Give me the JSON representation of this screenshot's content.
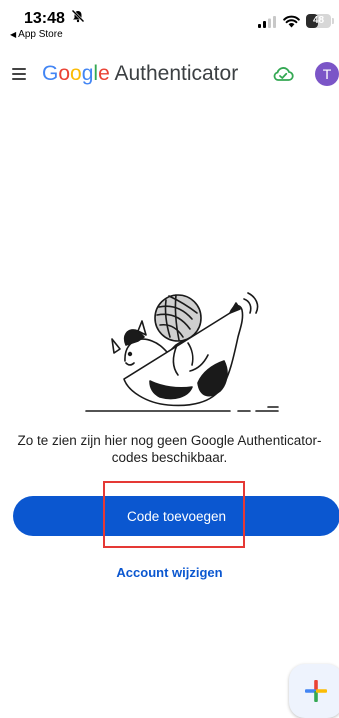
{
  "status_bar": {
    "time": "13:48",
    "back_label": "App Store",
    "battery": "48",
    "battery_level": 0.48,
    "icons": [
      "bell-slash-icon",
      "signal-icon",
      "wifi-icon",
      "battery-icon"
    ]
  },
  "app_bar": {
    "logo_letters": [
      "G",
      "o",
      "o",
      "g",
      "l",
      "e"
    ],
    "logo_colors": [
      "#4285F4",
      "#EA4335",
      "#FBBC05",
      "#4285F4",
      "#34A853",
      "#EA4335"
    ],
    "title_suffix": " Authenticator",
    "avatar_initial": "T",
    "avatar_color": "#7b55c7",
    "sync_status_color": "#34A853",
    "icons": [
      "menu-icon",
      "cloud-check-icon"
    ]
  },
  "empty_state": {
    "illustration": "cat-with-yarn-ball",
    "message": "Zo te zien zijn hier nog geen Google Authenticator-codes beschikbaar.",
    "primary_button": "Code toevoegen",
    "secondary_link": "Account wijzigen"
  },
  "fab": {
    "icon": "plus-icon",
    "colors": [
      "#EA4335",
      "#4285F4",
      "#34A853",
      "#FBBC05"
    ]
  },
  "accent": "#0b57d0",
  "highlight_color": "#e53935"
}
